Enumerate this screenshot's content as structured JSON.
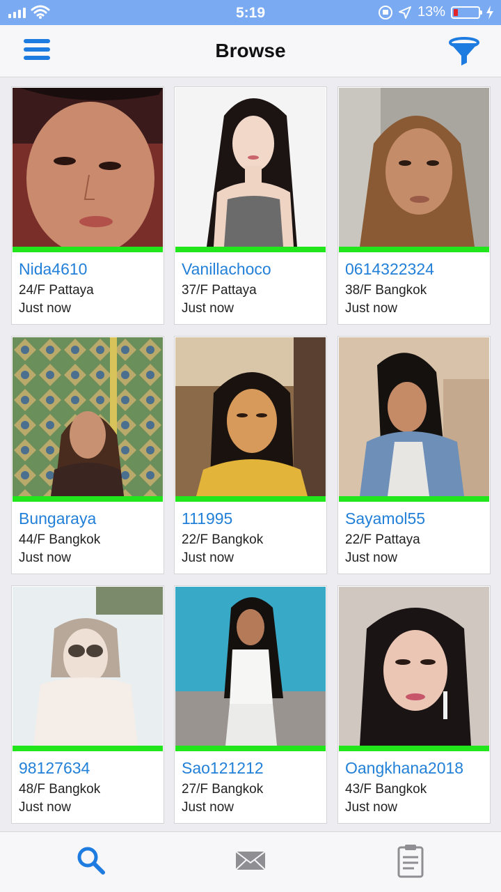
{
  "status_bar": {
    "time": "5:19",
    "battery_percent": "13%",
    "battery_level": 0.13,
    "battery_color": "#e0242a"
  },
  "header": {
    "title": "Browse",
    "menu_icon": "hamburger-menu-icon",
    "filter_icon": "filter-funnel-icon",
    "accent_color": "#1e7ce0"
  },
  "profiles": [
    {
      "name": "Nida4610",
      "details": "24/F Pattaya",
      "last_seen": "Just now",
      "online": true
    },
    {
      "name": "Vanillachoco",
      "details": "37/F Pattaya",
      "last_seen": "Just now",
      "online": true
    },
    {
      "name": "0614322324",
      "details": "38/F Bangkok",
      "last_seen": "Just now",
      "online": true
    },
    {
      "name": "Bungaraya",
      "details": "44/F Bangkok",
      "last_seen": "Just now",
      "online": true
    },
    {
      "name": "111995",
      "details": "22/F Bangkok",
      "last_seen": "Just now",
      "online": true
    },
    {
      "name": "Sayamol55",
      "details": "22/F Pattaya",
      "last_seen": "Just now",
      "online": true
    },
    {
      "name": "98127634",
      "details": "48/F Bangkok",
      "last_seen": "Just now",
      "online": true
    },
    {
      "name": "Sao121212",
      "details": "27/F Bangkok",
      "last_seen": "Just now",
      "online": true
    },
    {
      "name": "Oangkhana2018",
      "details": "43/F Bangkok",
      "last_seen": "Just now",
      "online": true
    }
  ],
  "tab_bar": {
    "tabs": [
      {
        "icon": "search-icon",
        "active": true
      },
      {
        "icon": "envelope-icon",
        "active": false
      },
      {
        "icon": "clipboard-icon",
        "active": false
      }
    ]
  }
}
